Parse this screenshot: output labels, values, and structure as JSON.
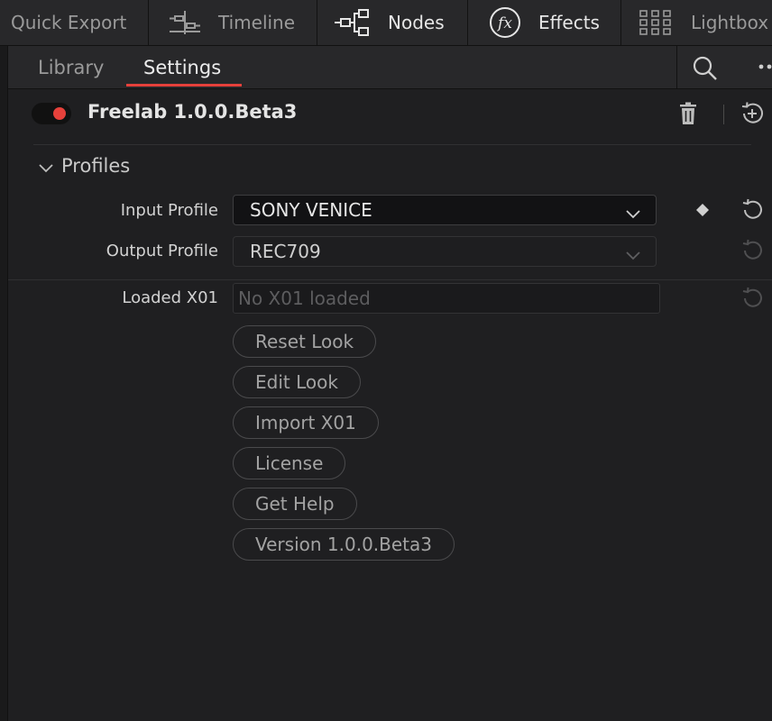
{
  "toolbar": {
    "quick_export": "Quick Export",
    "timeline": "Timeline",
    "nodes": "Nodes",
    "effects": "Effects",
    "lightbox": "Lightbox"
  },
  "tabs": {
    "library": "Library",
    "settings": "Settings"
  },
  "plugin": {
    "title": "Freelab 1.0.0.Beta3",
    "enabled": true
  },
  "profiles": {
    "section_title": "Profiles",
    "input_label": "Input Profile",
    "input_value": "SONY VENICE",
    "output_label": "Output Profile",
    "output_value": "REC709",
    "x01_label": "Loaded X01",
    "x01_placeholder": "No X01 loaded"
  },
  "buttons": {
    "reset_look": "Reset Look",
    "edit_look": "Edit Look",
    "import_x01": "Import X01",
    "license": "License",
    "get_help": "Get Help",
    "version": "Version 1.0.0.Beta3"
  },
  "colors": {
    "accent": "#e6413b",
    "background": "#1f1f21",
    "toolbar": "#28282a"
  }
}
